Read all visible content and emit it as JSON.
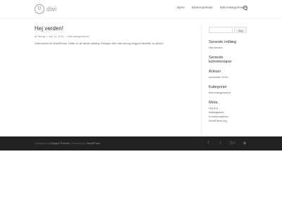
{
  "header": {
    "logo_mark": "D",
    "logo_text": "divi",
    "nav": [
      "Hjem",
      "Eksempelside",
      "Ikke-kategoriseret"
    ]
  },
  "post": {
    "title": "Hej verden!",
    "meta": {
      "author_prefix": "af",
      "author": "tbfrog",
      "sep1": " | ",
      "date": "nov 11, 2016",
      "sep2": " | ",
      "category": "Ikke-kategoriseret"
    },
    "body": "Velkommen til WordPress. Dette er dit første indlæg. Redigér eller slet det og begynd derefter at skrive!"
  },
  "sidebar": {
    "search_button": "Søg",
    "widgets": [
      {
        "title": "Seneste indlæg",
        "links": [
          "Hej verden!"
        ]
      },
      {
        "title": "Seneste kommentarer",
        "links": []
      },
      {
        "title": "Arkiver",
        "links": [
          "november 2016"
        ]
      },
      {
        "title": "Kategorier",
        "links": [
          "Ikke-kategoriseret"
        ]
      },
      {
        "title": "Meta",
        "links": [
          "Log ind",
          "Indlægsfeed",
          "Kommentarfeed",
          "WordPress.org"
        ]
      }
    ]
  },
  "footer": {
    "credit_prefix": "Designed by ",
    "designer": "Elegant Themes",
    "credit_mid": " | Powered by ",
    "platform": "WordPress",
    "social": [
      {
        "name": "facebook-icon",
        "glyph": "f"
      },
      {
        "name": "twitter-icon",
        "glyph": "t"
      },
      {
        "name": "google-plus-icon",
        "glyph": "G+"
      },
      {
        "name": "rss-icon",
        "glyph": "◉"
      }
    ]
  },
  "colors": {
    "footer_bg": "#222222",
    "title": "#333333",
    "text": "#666666"
  }
}
